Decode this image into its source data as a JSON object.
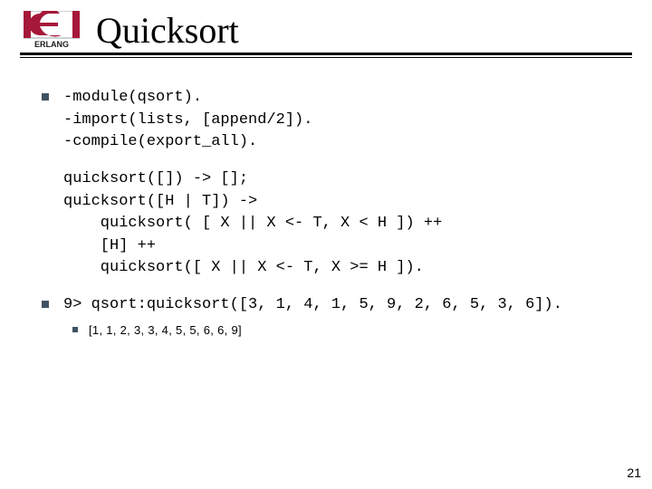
{
  "header": {
    "title": "Quicksort",
    "logo_alt": "ERLANG"
  },
  "bullets": {
    "module_directives": "-module(qsort).\n-import(lists, [append/2]).\n-compile(export_all).",
    "function_body": "quicksort([]) -> [];\nquicksort([H | T]) ->\n    quicksort( [ X || X <- T, X < H ]) ++\n    [H] ++\n    quicksort([ X || X <- T, X >= H ]).",
    "shell_call": "9> qsort:quicksort([3, 1, 4, 1, 5, 9, 2, 6, 5, 3, 6]).",
    "shell_result": "[1, 1, 2, 3, 3, 4, 5, 5, 6, 6, 9]"
  },
  "page_number": "21"
}
